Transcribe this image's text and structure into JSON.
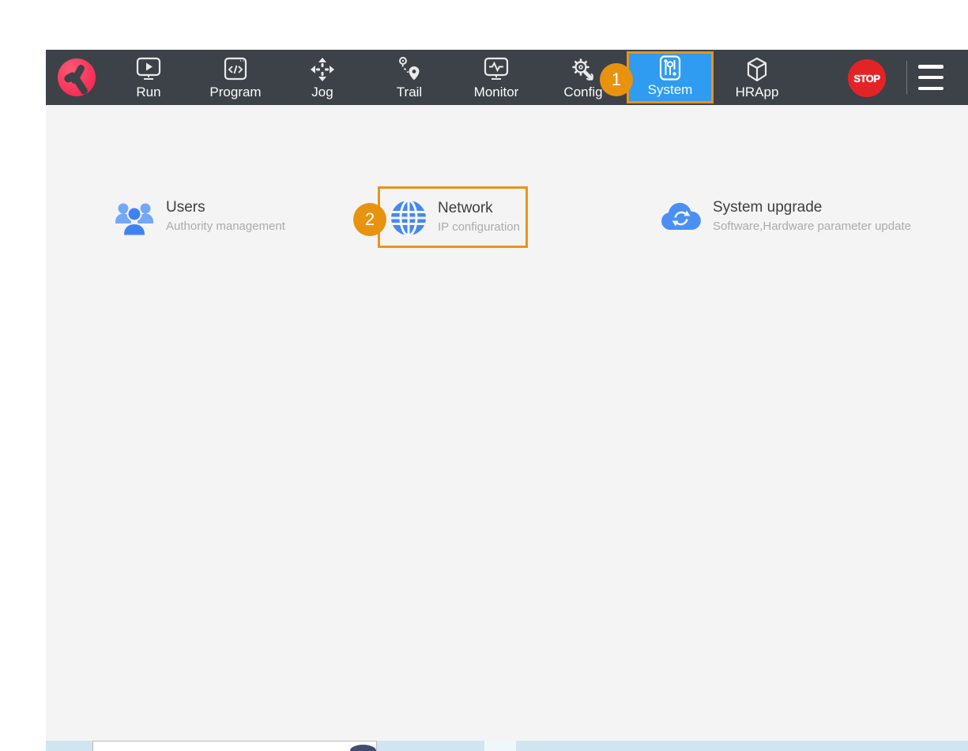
{
  "colors": {
    "topbar_bg": "#3d4248",
    "content_bg": "#f4f4f5",
    "active_tab_blue": "#2f9cf1",
    "annotation_orange": "#e8941c",
    "stop_red": "#e32426",
    "logo_pink": "#f52e55",
    "tile_icon_blue": "#4488f0"
  },
  "topbar": {
    "items": [
      {
        "label": "Run"
      },
      {
        "label": "Program"
      },
      {
        "label": "Jog"
      },
      {
        "label": "Trail"
      },
      {
        "label": "Monitor"
      },
      {
        "label": "Config"
      },
      {
        "label": "System"
      },
      {
        "label": "HRApp"
      }
    ],
    "active_item": "System",
    "stop_label": "STOP"
  },
  "annotations": {
    "step1": "1",
    "step2": "2"
  },
  "tiles": [
    {
      "title": "Users",
      "subtitle": "Authority management"
    },
    {
      "title": "Network",
      "subtitle": "IP configuration",
      "highlighted": true
    },
    {
      "title": "System upgrade",
      "subtitle": "Software,Hardware parameter update"
    }
  ]
}
